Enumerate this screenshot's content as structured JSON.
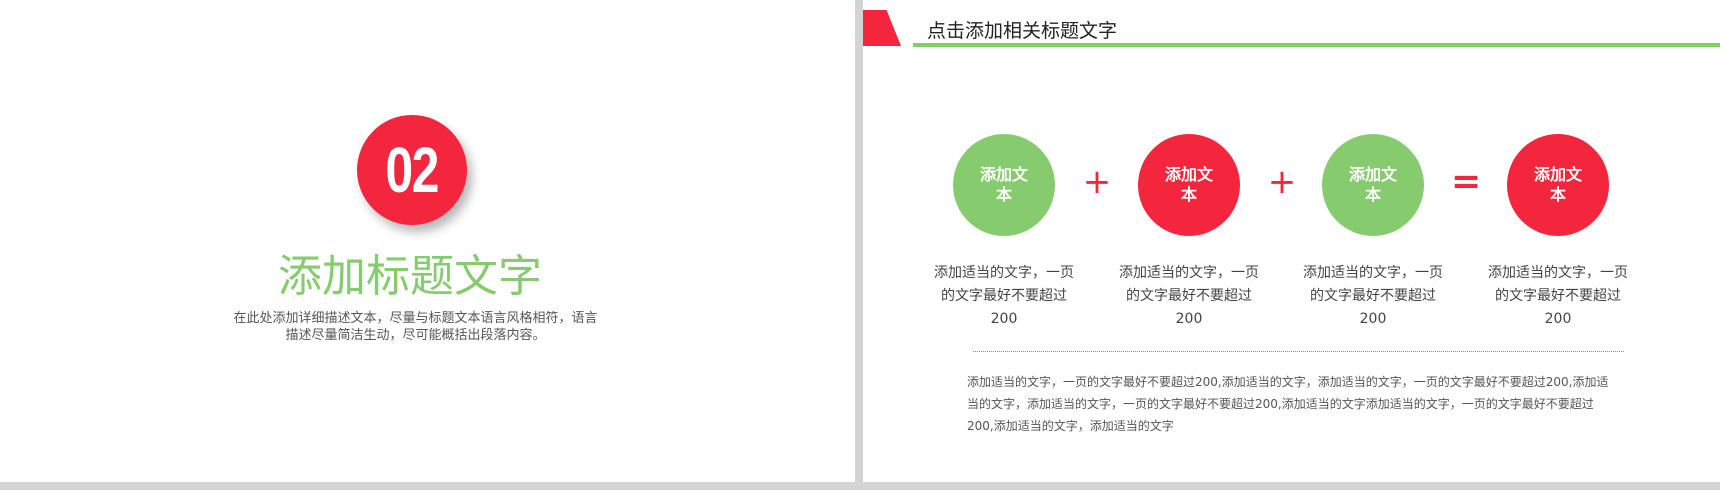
{
  "left_slide": {
    "number": "02",
    "title": "添加标题文字",
    "description": "在此处添加详细描述文本，尽量与标题文本语言风格相符，语言描述尽量简洁生动，尽可能概括出段落内容。"
  },
  "right_slide": {
    "header_title": "点击添加相关标题文字",
    "equation": [
      {
        "label": "添加文本",
        "color": "green"
      },
      {
        "operator": "+"
      },
      {
        "label": "添加文本",
        "color": "red"
      },
      {
        "operator": "+"
      },
      {
        "label": "添加文本",
        "color": "green"
      },
      {
        "operator": "="
      },
      {
        "label": "添加文本",
        "color": "red"
      }
    ],
    "captions": [
      "添加适当的文字，一页的文字最好不要超过200",
      "添加适当的文字，一页的文字最好不要超过200",
      "添加适当的文字，一页的文字最好不要超过200",
      "添加适当的文字，一页的文字最好不要超过200"
    ],
    "footer_text": "添加适当的文字，一页的文字最好不要超过200,添加适当的文字，添加适当的文字，一页的文字最好不要超过200,添加适当的文字，添加适当的文字，一页的文字最好不要超过200,添加适当的文字添加适当的文字，一页的文字最好不要超过200,添加适当的文字，添加适当的文字"
  },
  "colors": {
    "accent_red": "#f3263d",
    "accent_green": "#86cc6f"
  }
}
